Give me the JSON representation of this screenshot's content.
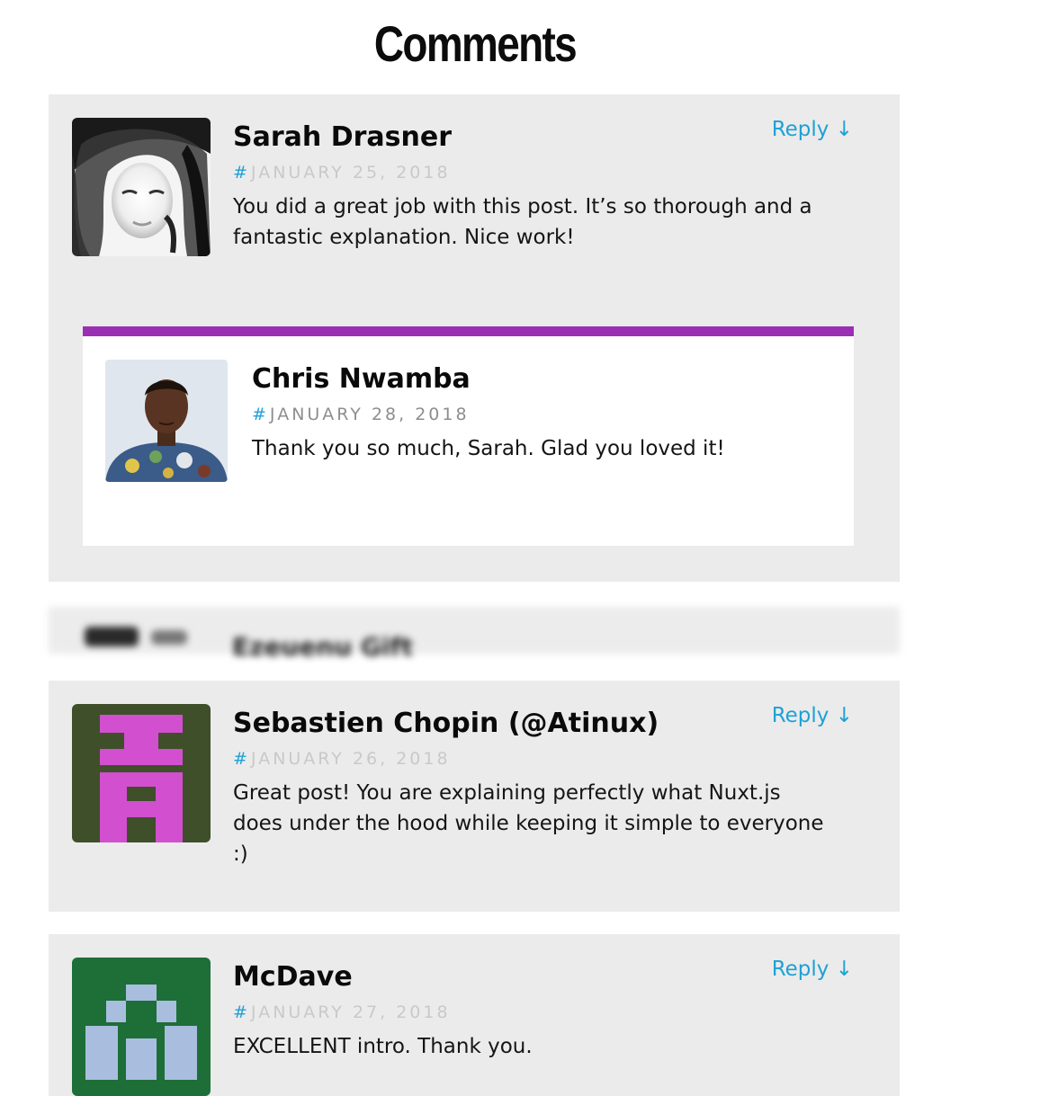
{
  "page": {
    "title": "Comments"
  },
  "comments": [
    {
      "author": "Sarah Drasner",
      "permalink_symbol": "#",
      "date": "JANUARY 25, 2018",
      "text": "You did a great job with this post. It’s so thorough and a fantastic explanation. Nice work!",
      "reply_label": "Reply ↓",
      "avatar": "photo-avatar",
      "replies": [
        {
          "author": "Chris Nwamba",
          "permalink_symbol": "#",
          "date": "JANUARY 28, 2018",
          "text": "Thank you so much, Sarah. Glad you loved it!",
          "avatar": "photo-avatar",
          "accent_color": "#9b2fb4"
        }
      ]
    },
    {
      "author": "Ezeuenu Gift",
      "blurred": true
    },
    {
      "author": "Sebastien Chopin (@Atinux)",
      "permalink_symbol": "#",
      "date": "JANUARY 26, 2018",
      "text": "Great post! You are explaining perfectly what Nuxt.js does under the hood while keeping it simple to everyone :)",
      "reply_label": "Reply ↓",
      "avatar": "identicon-avatar",
      "avatar_colors": {
        "background": "#3f4f2a",
        "foreground": "#d24fd0"
      }
    },
    {
      "author": "McDave",
      "permalink_symbol": "#",
      "date": "JANUARY 27, 2018",
      "text": "EXCELLENT intro. Thank you.",
      "reply_label": "Reply ↓",
      "avatar": "identicon-avatar",
      "avatar_colors": {
        "background": "#1e6e38",
        "foreground": "#a9bedf"
      }
    }
  ],
  "colors": {
    "card_background": "#ebebeb",
    "link": "#1ea1d6",
    "date_text": "#c9c9c9",
    "reply_accent": "#9b2fb4"
  }
}
